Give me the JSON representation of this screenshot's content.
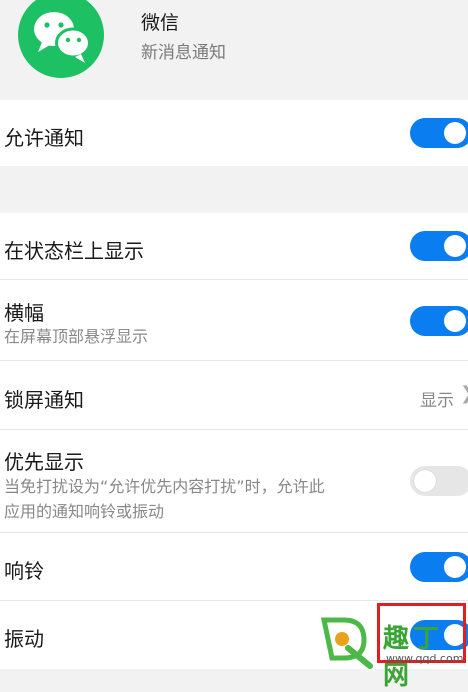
{
  "header": {
    "app_name": "微信",
    "subtitle": "新消息通知",
    "icon": "wechat-logo-icon",
    "icon_color": "#1dc063"
  },
  "settings": {
    "allow_notifications": {
      "label": "允许通知",
      "enabled": true
    },
    "status_bar": {
      "label": "在状态栏上显示",
      "enabled": true
    },
    "banner": {
      "label": "横幅",
      "description": "在屏幕顶部悬浮显示",
      "enabled": true
    },
    "lockscreen": {
      "label": "锁屏通知",
      "value": "显示",
      "chevron": "chevron-right-icon"
    },
    "priority": {
      "label": "优先显示",
      "description_line1": "当免打扰设为“允许优先内容打扰”时，允许此",
      "description_line2": "应用的通知响铃或振动",
      "enabled": false
    },
    "ringtone": {
      "label": "响铃",
      "enabled": true
    },
    "vibrate": {
      "label": "振动",
      "enabled": true
    }
  },
  "colors": {
    "toggle_on": "#0a7df0",
    "toggle_off": "#e6e6e6",
    "highlight_border": "#e02020",
    "background": "#f2f2f2"
  },
  "watermark": {
    "text": "趣丁网",
    "url": "www.qqd.com"
  }
}
